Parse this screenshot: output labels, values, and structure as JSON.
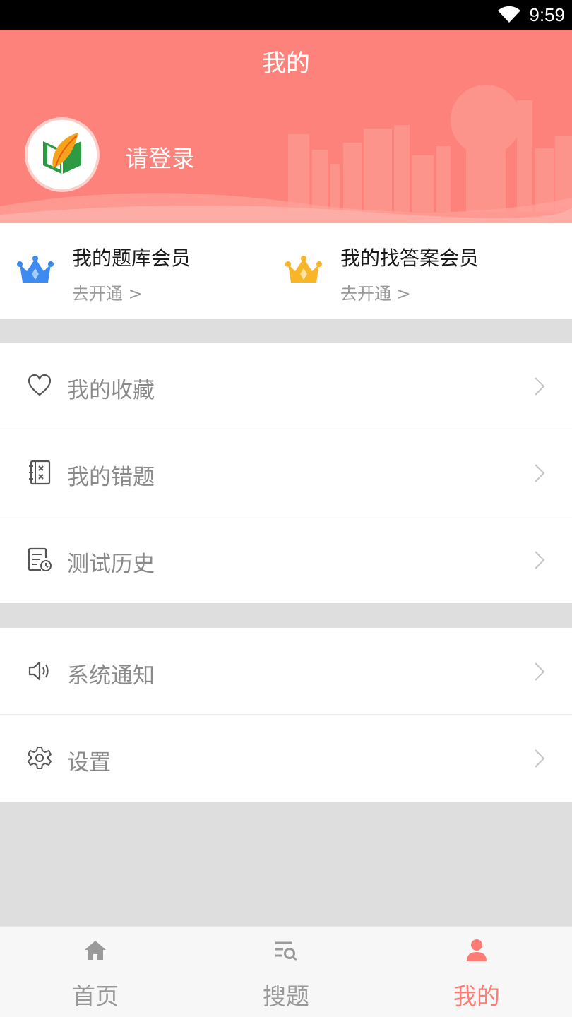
{
  "status_bar": {
    "time": "9:59"
  },
  "header": {
    "title": "我的",
    "login_text": "请登录"
  },
  "members": [
    {
      "title": "我的题库会员",
      "subtitle": "去开通 >",
      "crown_color": "#3d8bf2"
    },
    {
      "title": "我的找答案会员",
      "subtitle": "去开通 >",
      "crown_color": "#f8b527"
    }
  ],
  "menu_group_1": [
    {
      "label": "我的收藏",
      "icon": "heart-icon"
    },
    {
      "label": "我的错题",
      "icon": "wrong-book-icon"
    },
    {
      "label": "测试历史",
      "icon": "history-icon"
    }
  ],
  "menu_group_2": [
    {
      "label": "系统通知",
      "icon": "speaker-icon"
    },
    {
      "label": "设置",
      "icon": "gear-icon"
    }
  ],
  "tabs": [
    {
      "label": "首页",
      "icon": "home-icon"
    },
    {
      "label": "搜题",
      "icon": "search-list-icon"
    },
    {
      "label": "我的",
      "icon": "user-icon",
      "active": true
    }
  ],
  "colors": {
    "accent": "#fd827b",
    "active_tab": "#fd7c74",
    "background": "#dedede"
  }
}
